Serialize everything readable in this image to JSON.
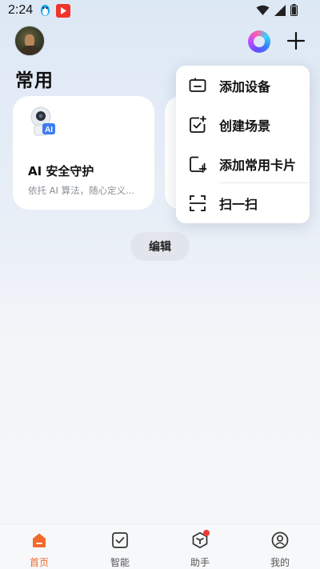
{
  "status_bar": {
    "time": "2:24"
  },
  "header": {
    "page_title": "常用"
  },
  "card": {
    "badge_text": "AI",
    "title": "AI 安全守护",
    "description": "依托 AI 算法，随心定义..."
  },
  "edit_button_label": "编辑",
  "popup_menu": {
    "items": [
      {
        "label": "添加设备",
        "icon": "device-add-icon"
      },
      {
        "label": "创建场景",
        "icon": "scene-create-icon"
      },
      {
        "label": "添加常用卡片",
        "icon": "card-add-icon"
      },
      {
        "label": "扫一扫",
        "icon": "scan-icon"
      }
    ]
  },
  "bottom_nav": {
    "items": [
      {
        "label": "首页",
        "icon": "home-icon",
        "active": true
      },
      {
        "label": "智能",
        "icon": "smart-check-icon",
        "active": false
      },
      {
        "label": "助手",
        "icon": "assistant-cube-icon",
        "active": false,
        "badge": true
      },
      {
        "label": "我的",
        "icon": "profile-icon",
        "active": false
      }
    ]
  },
  "colors": {
    "accent": "#f26a2b",
    "badge": "#f03a3a",
    "card_bg": "#ffffff",
    "background_top": "#dde8f5"
  }
}
